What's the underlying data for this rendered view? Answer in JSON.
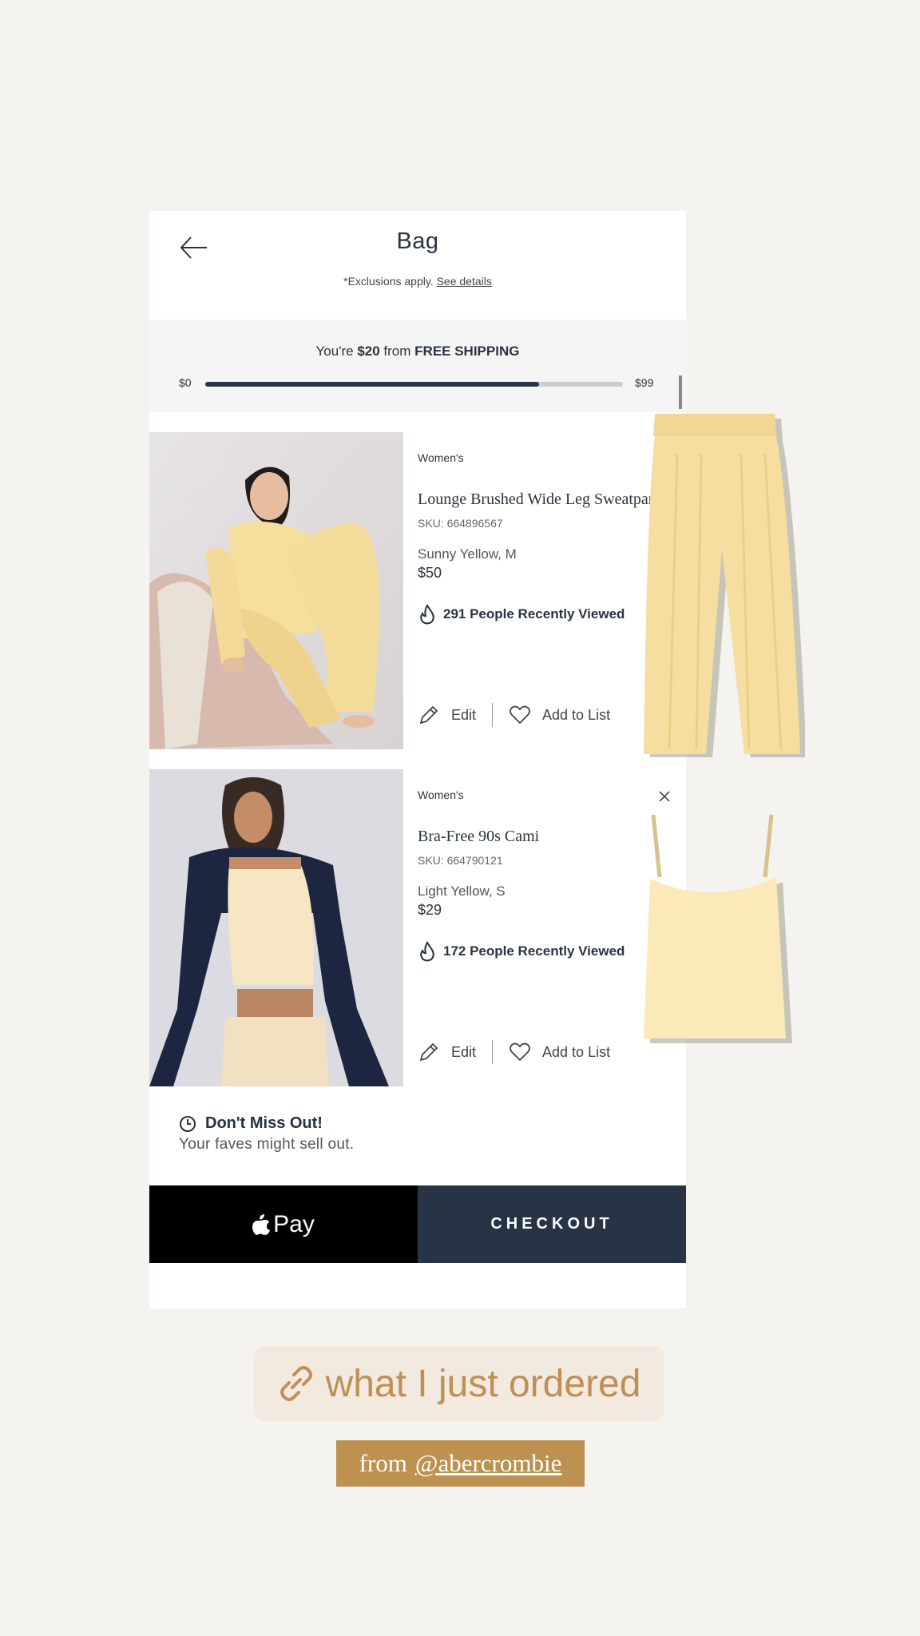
{
  "header": {
    "title": "Bag",
    "exclusions_prefix": "*Exclusions apply.",
    "see_details": "See details"
  },
  "shipping": {
    "msg_prefix": "You're",
    "amount": "$20",
    "msg_mid": "from",
    "free_shipping": "FREE SHIPPING",
    "min_label": "$0",
    "max_label": "$99",
    "progress": 0.8
  },
  "items": [
    {
      "gender": "Women's",
      "name": "Lounge Brushed Wide Leg Sweatpant",
      "sku": "SKU: 664896567",
      "variant": "Sunny Yellow, M",
      "price": "$50",
      "viewed": "291 People Recently Viewed",
      "edit": "Edit",
      "add_to_list": "Add to List"
    },
    {
      "gender": "Women's",
      "name": "Bra-Free 90s Cami",
      "sku": "SKU: 664790121",
      "variant": "Light Yellow, S",
      "price": "$29",
      "viewed": "172 People Recently Viewed",
      "edit": "Edit",
      "add_to_list": "Add to List"
    }
  ],
  "dont_miss": {
    "title": "Don't Miss Out!",
    "subtitle": "Your faves might sell out."
  },
  "paybar": {
    "apple_pay": "Pay",
    "checkout": "CHECKOUT"
  },
  "story": {
    "link_sticker": "what I just ordered",
    "from": "from",
    "handle": "@abercrombie"
  },
  "colors": {
    "background": "#f4f3ef",
    "navy": "#263446",
    "sticker_text": "#bf8f56",
    "from_bg": "#bd9150",
    "pant_yellow": "#f5dea0",
    "cami_yellow": "#fbeab8"
  }
}
